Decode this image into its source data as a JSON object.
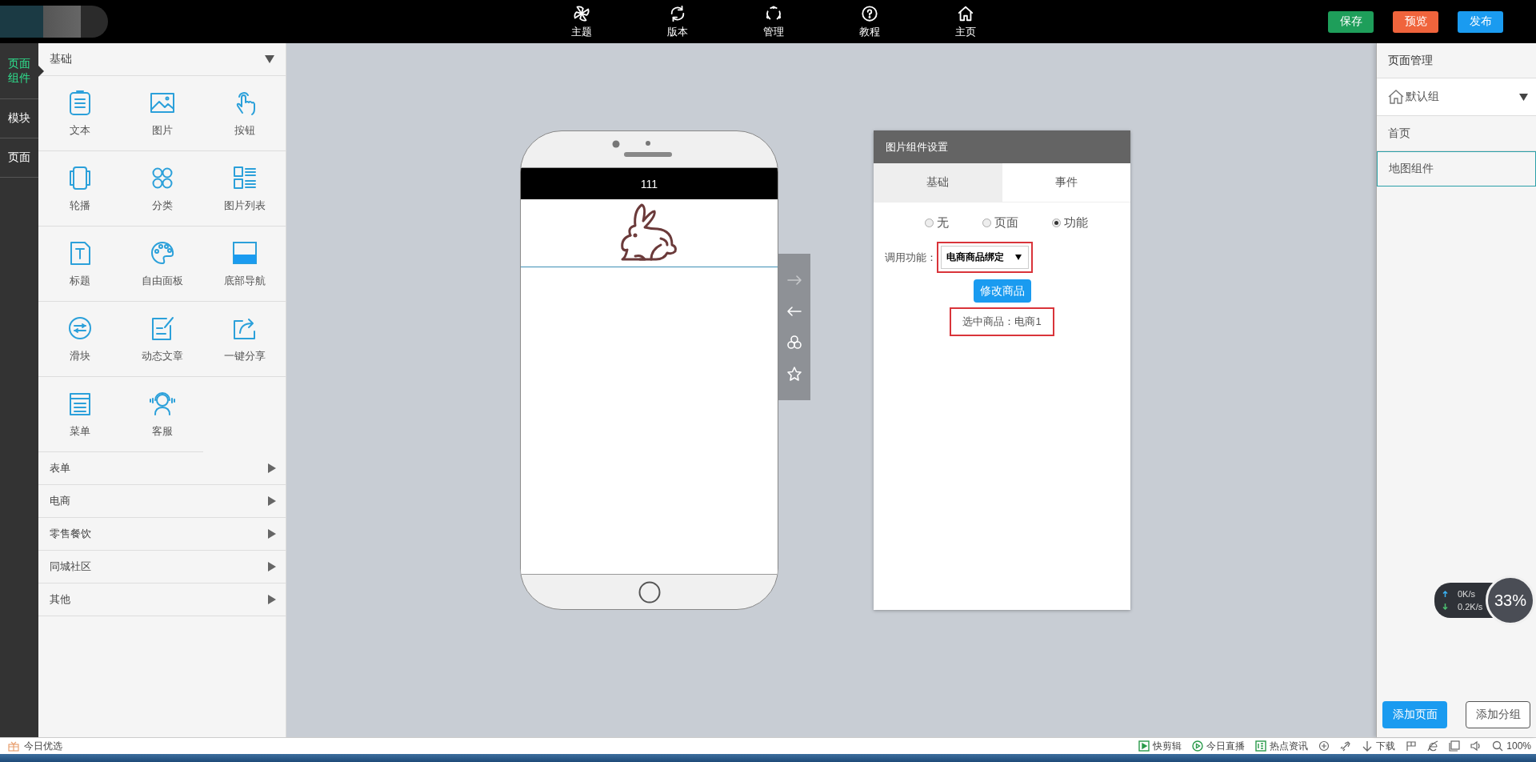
{
  "top_bar": {
    "nav": [
      {
        "label": "主题"
      },
      {
        "label": "版本"
      },
      {
        "label": "管理"
      },
      {
        "label": "教程"
      },
      {
        "label": "主页"
      }
    ],
    "actions": [
      {
        "label": "保存",
        "color": "#1e9e5a"
      },
      {
        "label": "预览",
        "color": "#f0643c"
      },
      {
        "label": "发布",
        "color": "#1a9bf0"
      }
    ]
  },
  "left_rail": {
    "items": [
      {
        "label": "页面组件",
        "selected": true
      },
      {
        "label": "模块",
        "selected": false
      },
      {
        "label": "页面",
        "selected": false
      }
    ]
  },
  "components": {
    "header": "基础",
    "expanded": true,
    "items": [
      {
        "label": "文本"
      },
      {
        "label": "图片"
      },
      {
        "label": "按钮"
      },
      {
        "label": "轮播"
      },
      {
        "label": "分类"
      },
      {
        "label": "图片列表"
      },
      {
        "label": "标题"
      },
      {
        "label": "自由面板"
      },
      {
        "label": "底部导航"
      },
      {
        "label": "滑块"
      },
      {
        "label": "动态文章"
      },
      {
        "label": "一键分享"
      },
      {
        "label": "菜单"
      },
      {
        "label": "客服"
      }
    ]
  },
  "categories": [
    {
      "label": "表单",
      "expanded": false
    },
    {
      "label": "电商",
      "expanded": false
    },
    {
      "label": "零售餐饮",
      "expanded": false
    },
    {
      "label": "同城社区",
      "expanded": false
    },
    {
      "label": "其他",
      "expanded": false
    }
  ],
  "phone": {
    "title": "111"
  },
  "settings": {
    "title": "图片组件设置",
    "tabs": [
      {
        "label": "基础",
        "selected": false
      },
      {
        "label": "事件",
        "selected": true
      }
    ],
    "link_types": [
      {
        "label": "无",
        "selected": false
      },
      {
        "label": "页面",
        "selected": false
      },
      {
        "label": "功能",
        "selected": true
      }
    ],
    "function_label": "调用功能：",
    "function_value": "电商商品绑定",
    "edit_button": "修改商品",
    "selected_product": "选中商品：电商1"
  },
  "page_manager": {
    "title": "页面管理",
    "group": "默认组",
    "pages": [
      {
        "label": "首页",
        "selected": false
      },
      {
        "label": "地图组件",
        "selected": true
      }
    ],
    "buttons": [
      "添加页面",
      "添加分组"
    ]
  },
  "net_monitor": {
    "upload": "0K/s",
    "download": "0.2K/s",
    "usage": "33%"
  },
  "status_bar": {
    "left": "今日优选",
    "items": [
      {
        "kind": "app",
        "label": "快剪辑"
      },
      {
        "kind": "app",
        "label": "今日直播"
      },
      {
        "kind": "app",
        "label": "热点资讯"
      },
      {
        "kind": "icon"
      },
      {
        "kind": "icon"
      },
      {
        "kind": "app",
        "label": "下载"
      },
      {
        "kind": "icon"
      },
      {
        "kind": "icon"
      },
      {
        "kind": "icon"
      },
      {
        "kind": "icon"
      },
      {
        "kind": "app",
        "label": "100%"
      }
    ]
  }
}
